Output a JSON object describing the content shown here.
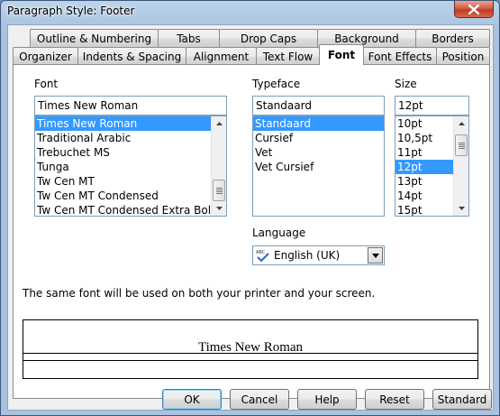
{
  "window": {
    "title": "Paragraph Style: Footer"
  },
  "tabs_row1": [
    {
      "label": "Outline & Numbering"
    },
    {
      "label": "Tabs"
    },
    {
      "label": "Drop Caps"
    },
    {
      "label": "Background"
    },
    {
      "label": "Borders"
    }
  ],
  "tabs_row2": [
    {
      "label": "Organizer"
    },
    {
      "label": "Indents & Spacing"
    },
    {
      "label": "Alignment"
    },
    {
      "label": "Text Flow"
    },
    {
      "label": "Font",
      "active": true
    },
    {
      "label": "Font Effects"
    },
    {
      "label": "Position"
    }
  ],
  "font": {
    "label": "Font",
    "value": "Times New Roman",
    "items": [
      "Times New Roman",
      "Traditional Arabic",
      "Trebuchet MS",
      "Tunga",
      "Tw Cen MT",
      "Tw Cen MT Condensed",
      "Tw Cen MT Condensed Extra Bold"
    ],
    "selected": "Times New Roman"
  },
  "typeface": {
    "label": "Typeface",
    "value": "Standaard",
    "items": [
      "Standaard",
      "Cursief",
      "Vet",
      "Vet Cursief"
    ],
    "selected": "Standaard"
  },
  "size": {
    "label": "Size",
    "value": "12pt",
    "items": [
      "10pt",
      "10,5pt",
      "11pt",
      "12pt",
      "13pt",
      "14pt",
      "15pt"
    ],
    "selected": "12pt"
  },
  "language": {
    "label": "Language",
    "value": "English (UK)",
    "icon": "spellcheck-icon"
  },
  "info_text": "The same font will be used on both your printer and your screen.",
  "preview": {
    "text": "Times New Roman"
  },
  "buttons": {
    "ok": "OK",
    "cancel": "Cancel",
    "help": "Help",
    "reset": "Reset",
    "standard": "Standard"
  }
}
